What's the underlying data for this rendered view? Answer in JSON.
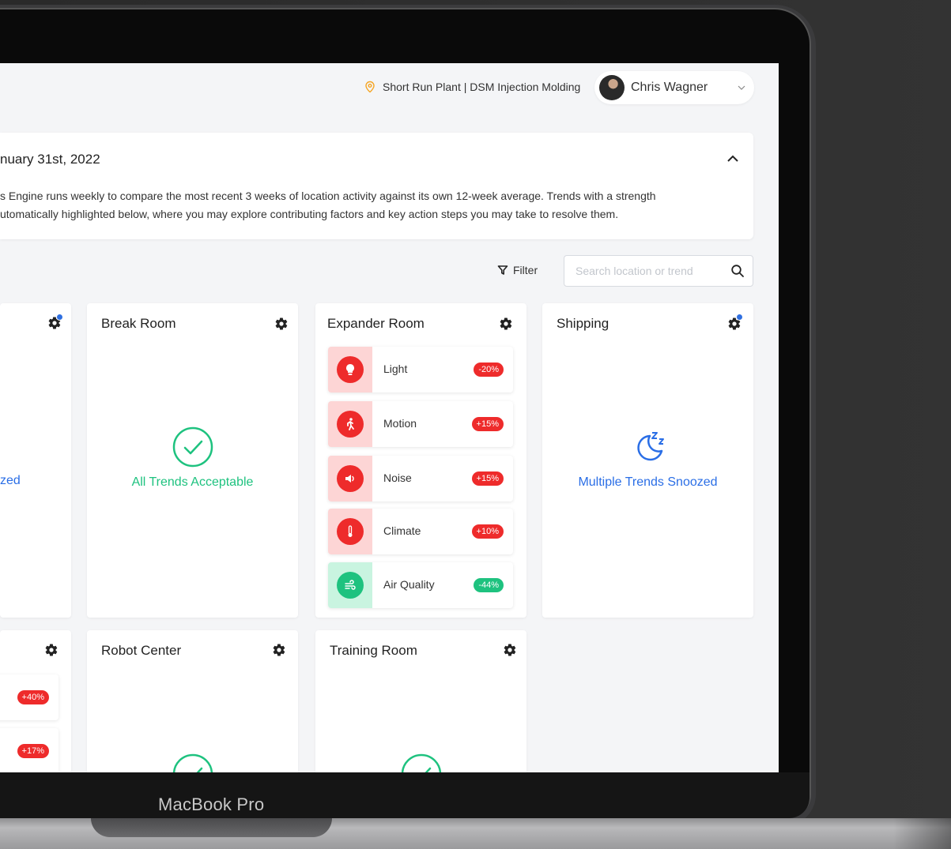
{
  "header": {
    "location": "Short Run Plant | DSM Injection Molding",
    "user_name": "Chris Wagner"
  },
  "report": {
    "title_partial": "nuary 31st, 2022",
    "text_line1": "s Engine runs weekly to compare the most recent 3 weeks of location activity against its own 12-week average. Trends with a strength",
    "text_line2": "utomatically highlighted below, where you may explore contributing factors and key action steps you may take to resolve them."
  },
  "toolbar": {
    "filter_label": "Filter",
    "search_placeholder": "Search location or trend"
  },
  "cards": {
    "partial_left": {
      "status_partial": "zed",
      "pill1": "+40%",
      "pill2": "+17%"
    },
    "break_room": {
      "title": "Break Room",
      "status": "All Trends Acceptable"
    },
    "expander_room": {
      "title": "Expander Room",
      "trends": [
        {
          "label": "Light",
          "value": "-20%"
        },
        {
          "label": "Motion",
          "value": "+15%"
        },
        {
          "label": "Noise",
          "value": "+15%"
        },
        {
          "label": "Climate",
          "value": "+10%"
        },
        {
          "label": "Air Quality",
          "value": "-44%"
        }
      ]
    },
    "shipping": {
      "title": "Shipping",
      "status": "Multiple Trends Snoozed"
    },
    "robot_center": {
      "title": "Robot Center"
    },
    "training_room": {
      "title": "Training Room"
    }
  },
  "device": {
    "label": "MacBook Pro"
  },
  "colors": {
    "accent_green": "#1ec27f",
    "accent_blue": "#2a6ee6",
    "alert_red": "#ee2b2b",
    "pin_orange": "#f5a524"
  }
}
